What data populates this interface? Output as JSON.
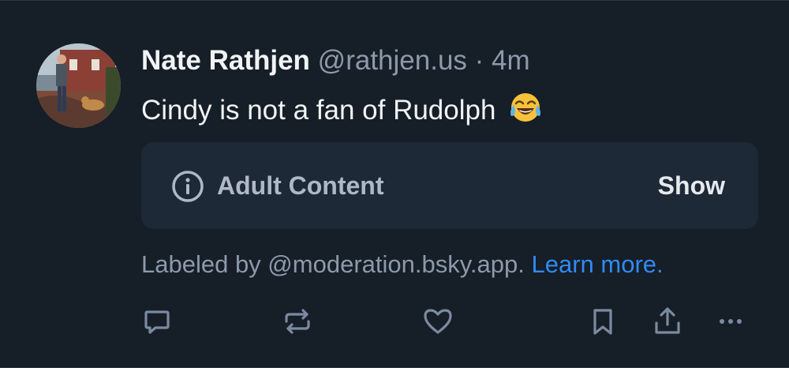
{
  "post": {
    "author_name": "Nate Rathjen",
    "handle": "@rathjen.us",
    "separator": "·",
    "time": "4m",
    "text": "Cindy is not a fan of Rudolph",
    "emoji": "face-with-tears-of-joy"
  },
  "content_warning": {
    "icon": "info-icon",
    "label": "Adult Content",
    "show_label": "Show"
  },
  "moderation": {
    "prefix": "Labeled by @moderation.bsky.app.",
    "link_text": "Learn more."
  },
  "actions": [
    {
      "name": "reply",
      "icon": "reply-icon"
    },
    {
      "name": "repost",
      "icon": "repost-icon"
    },
    {
      "name": "like",
      "icon": "heart-icon"
    },
    {
      "name": "bookmark",
      "icon": "bookmark-icon"
    },
    {
      "name": "share",
      "icon": "share-icon"
    },
    {
      "name": "more",
      "icon": "more-icon"
    }
  ],
  "colors": {
    "background": "#161e27",
    "card": "#1e2937",
    "muted_text": "#8d99ab",
    "link": "#2f8bf5",
    "icon": "#7b8aa0"
  }
}
